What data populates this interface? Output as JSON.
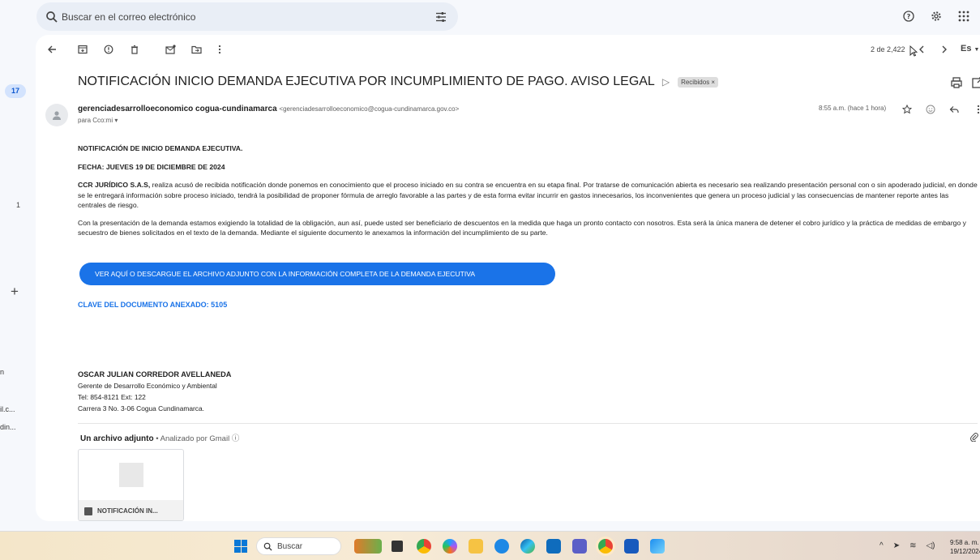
{
  "rail": {
    "badge": "17",
    "count": "1",
    "plus": "+",
    "item_a": "n",
    "item_b": "il.c...",
    "item_c": "din..."
  },
  "search": {
    "placeholder": "Buscar en el correo electrónico"
  },
  "toolbar": {
    "pager": "2 de 2,422",
    "lang": "Es"
  },
  "email": {
    "subject": "NOTIFICACIÓN INICIO DEMANDA EJECUTIVA POR INCUMPLIMIENTO DE PAGO. AVISO LEGAL",
    "label": "Recibidos ×",
    "sender_name": "gerenciadesarrolloeconomico cogua-cundinamarca",
    "sender_email": "<gerenciadesarrolloeconomico@cogua-cundinamarca.gov.co>",
    "recipients": "para Cco:mi ▾",
    "time": "8:55 a.m. (hace 1 hora)",
    "heading": "NOTIFICACIÓN DE INICIO DEMANDA EJECUTIVA.",
    "date_line": "FECHA: JUEVES 19 DE DICIEMBRE DE 2024",
    "company": "CCR JURÍDICO S.A.S,",
    "para1": " realiza acusó de recibida notificación donde ponemos en conocimiento que el proceso iniciado en su contra se encuentra en su etapa final. Por tratarse de comunicación abierta es necesario sea realizando presentación personal con o sin apoderado judicial, en donde se le entregará información sobre proceso iniciado, tendrá la posibilidad de proponer fórmula de arreglo favorable a las partes y de esta forma evitar incurrir en gastos innecesarios, los inconvenientes que genera un proceso judicial y las consecuencias de mantener reporte antes las centrales de riesgo.",
    "para2": "Con la presentación de la demanda estamos exigiendo la totalidad de la obligación, aun así, puede usted ser beneficiario de descuentos en la medida que haga un pronto contacto con nosotros. Esta será la única manera de detener el cobro jurídico y la práctica de medidas de embargo y secuestro de bienes solicitados en el texto de la demanda. Mediante el siguiente documento le anexamos la información del incumplimiento de su parte.",
    "cta": "VER AQUÍ O DESCARGUE EL ARCHIVO ADJUNTO CON LA INFORMACIÓN COMPLETA DE LA DEMANDA EJECUTIVA",
    "clave": "CLAVE DEL DOCUMENTO ANEXADO: 5105",
    "sig_name": "OSCAR JULIAN CORREDOR AVELLANEDA",
    "sig_title": "Gerente de Desarrollo Económico y Ambiental",
    "sig_tel": "Tel: 854-8121 Ext: 122",
    "sig_addr": "Carrera 3 No. 3-06 Cogua Cundinamarca.",
    "att_title": "Un archivo adjunto",
    "att_sub": " • Analizado por Gmail ⓘ",
    "att_name": "NOTIFICACIÓN IN..."
  },
  "taskbar": {
    "search": "Buscar",
    "time": "9:58 a. m.",
    "date": "19/12/2024"
  },
  "colors": {
    "accent": "#1a73e8",
    "background": "#f6f8fc",
    "search_bg": "#e9eef6"
  }
}
